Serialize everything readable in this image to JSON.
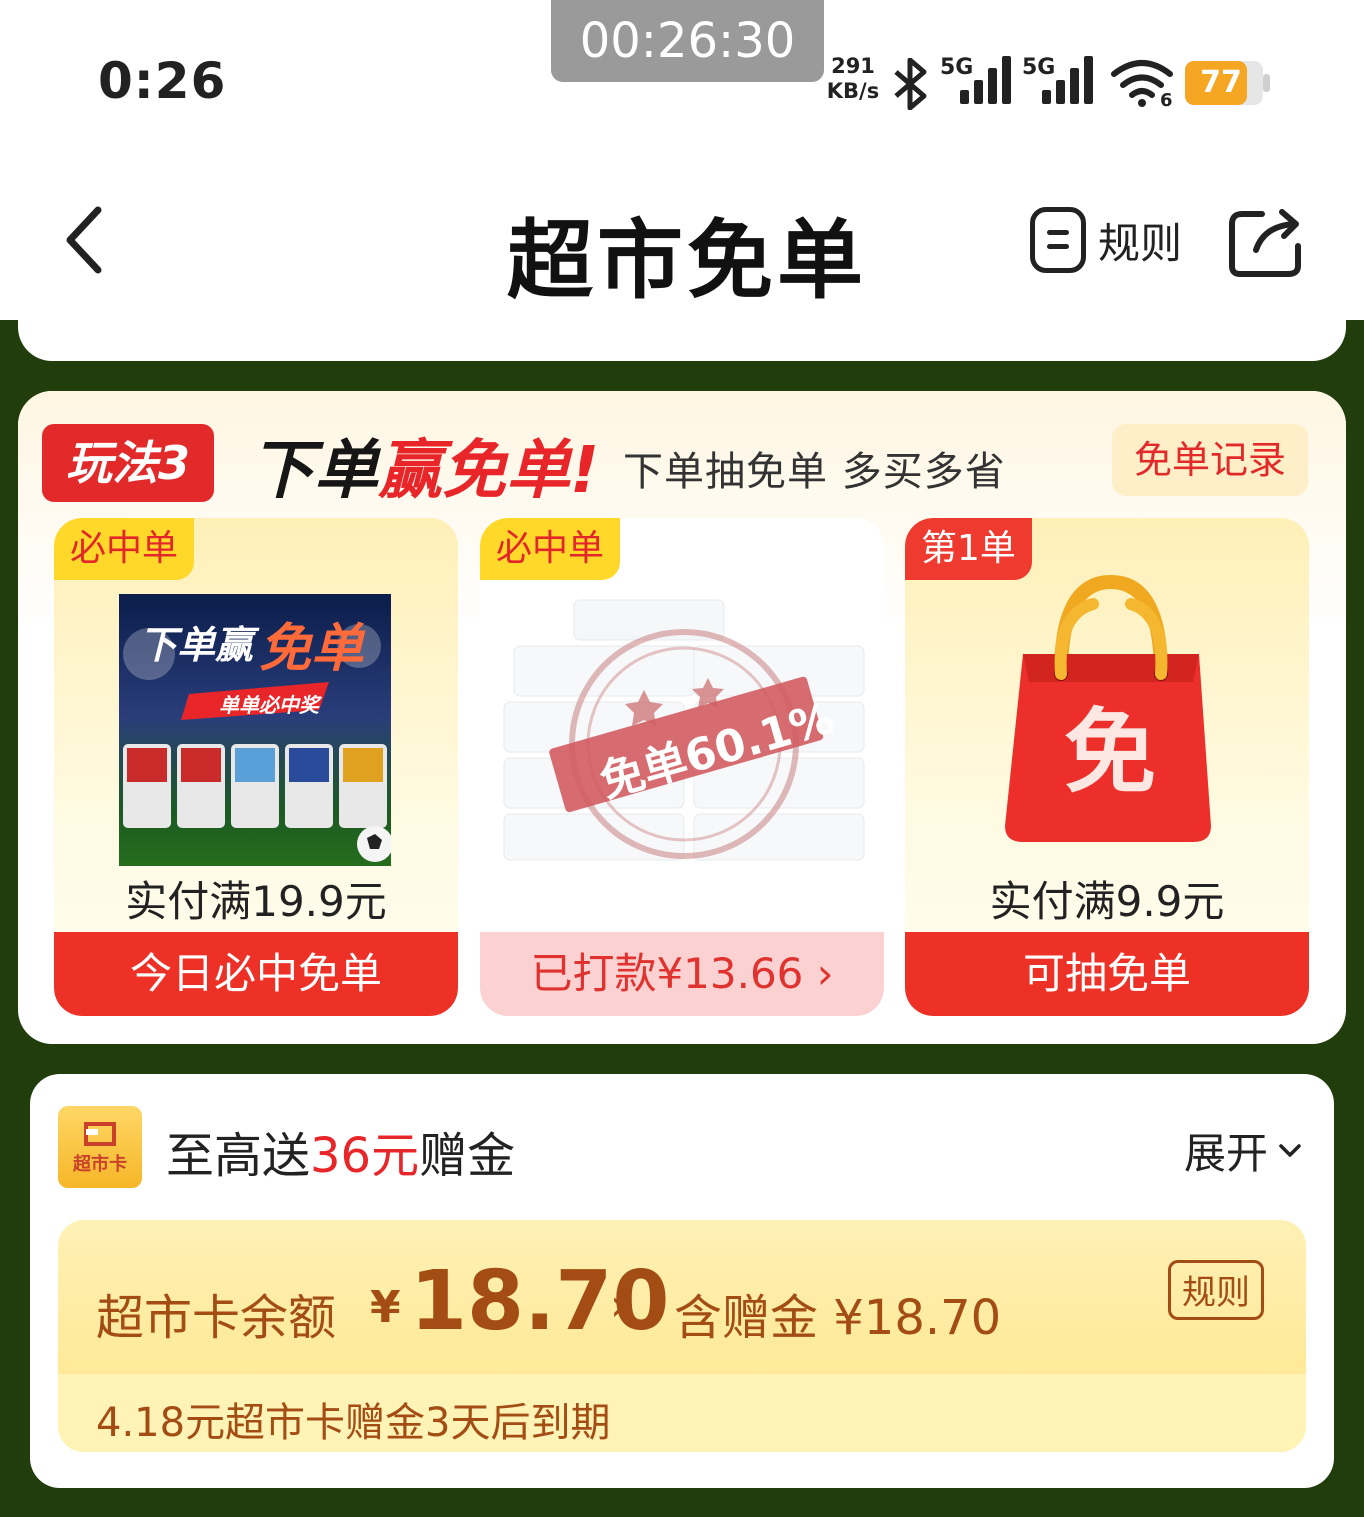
{
  "status_bar": {
    "time": "0:26",
    "recorder": "00:26:30",
    "net_speed_value": "291",
    "net_speed_unit": "KB/s",
    "sig1": "5G",
    "sig2": "5G",
    "wifi_sub": "6",
    "battery": "77"
  },
  "nav": {
    "title": "超市免单",
    "rules_label": "规则"
  },
  "play3": {
    "badge": "玩法3",
    "title_part1": "下单",
    "title_part2": "赢免单!",
    "subtitle": "下单抽免单 多买多省",
    "record_btn": "免单记录",
    "tiles": [
      {
        "tag": "必中单",
        "img_text1": "下单赢",
        "img_text2": "免单",
        "img_text3": "单单必中奖",
        "condition": "实付满19.9元",
        "action": "今日必中免单"
      },
      {
        "tag": "必中单",
        "stamp": "免单60.1%",
        "action": "已打款¥13.66 ›"
      },
      {
        "tag": "第1单",
        "bag_char": "免",
        "condition": "实付满9.9元",
        "action": "可抽免单"
      }
    ]
  },
  "card": {
    "icon_text": "超市卡",
    "headline_prefix": "至高送",
    "headline_highlight": "36元",
    "headline_suffix": "赠金",
    "expand": "展开",
    "balance_label": "超市卡余额",
    "balance_yen": "¥",
    "balance_amount": "18.70",
    "balance_chevron": "›",
    "included_label": "含赠金 ¥18.70",
    "rules": "规则",
    "expire_note": "4.18元超市卡赠金3天后到期"
  },
  "colors": {
    "page_bg": "#213d0c",
    "accent_red": "#e8262a",
    "tag_yellow": "#ffd82a",
    "card_text_brown": "#a34d14"
  }
}
